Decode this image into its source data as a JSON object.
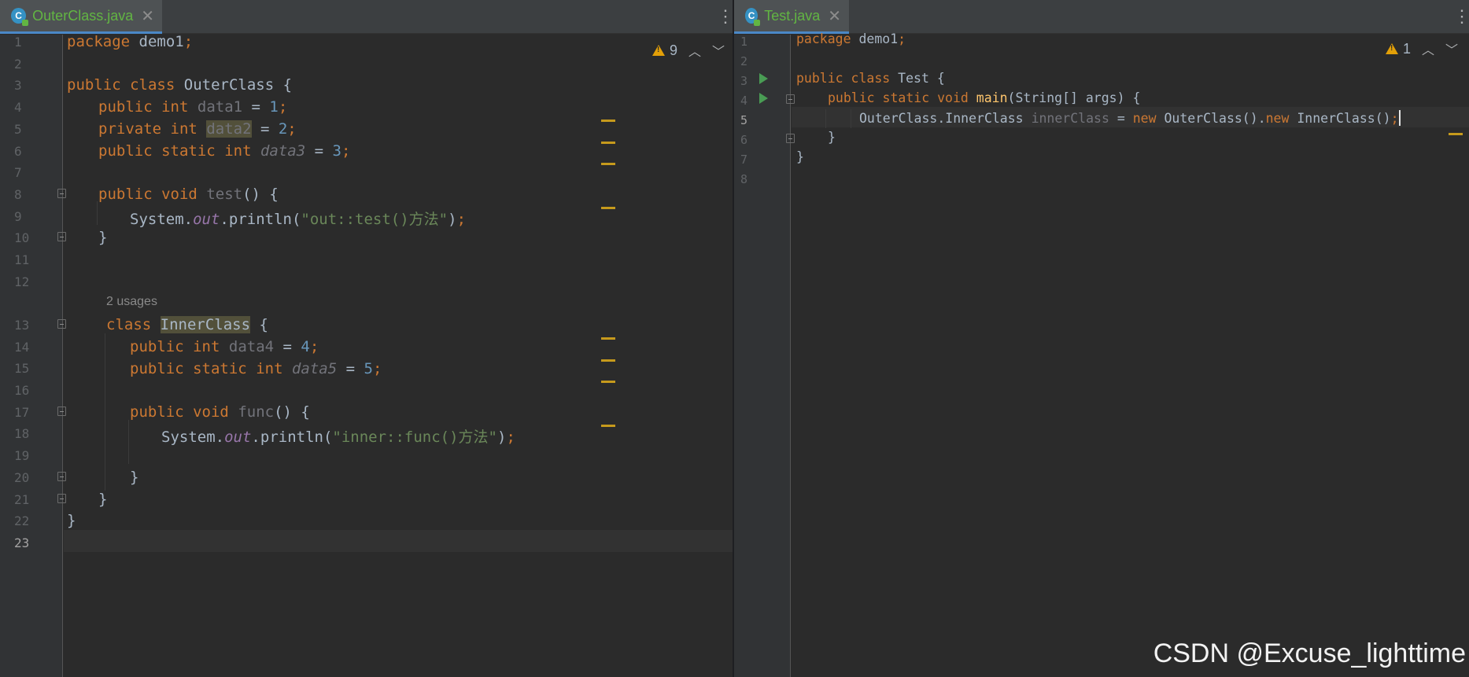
{
  "left_editor": {
    "tab": {
      "icon_letter": "C",
      "filename": "OuterClass.java",
      "close": "✕"
    },
    "inspections": {
      "warning_count": "9"
    },
    "lines": [
      {
        "n": "1"
      },
      {
        "n": "2"
      },
      {
        "n": "3"
      },
      {
        "n": "4"
      },
      {
        "n": "5"
      },
      {
        "n": "6"
      },
      {
        "n": "7"
      },
      {
        "n": "8"
      },
      {
        "n": "9"
      },
      {
        "n": "10"
      },
      {
        "n": "11"
      },
      {
        "n": "12"
      },
      {
        "n": "13"
      },
      {
        "n": "14"
      },
      {
        "n": "15"
      },
      {
        "n": "16"
      },
      {
        "n": "17"
      },
      {
        "n": "18"
      },
      {
        "n": "19"
      },
      {
        "n": "20"
      },
      {
        "n": "21"
      },
      {
        "n": "22"
      },
      {
        "n": "23"
      }
    ],
    "code": {
      "package_kw": "package",
      "package_name": "demo1",
      "public": "public",
      "private": "private",
      "class": "class",
      "int": "int",
      "static": "static",
      "void": "void",
      "outer_class": "OuterClass",
      "data1": "data1",
      "data2": "data2",
      "data3": "data3",
      "data4": "data4",
      "data5": "data5",
      "v1": "1",
      "v2": "2",
      "v3": "3",
      "v4": "4",
      "v5": "5",
      "test": "test",
      "func": "func",
      "system": "System",
      "out": "out",
      "println": "println",
      "str_test": "\"out::test()方法\"",
      "str_func": "\"inner::func()方法\"",
      "usages_hint": "2 usages",
      "inner_class": "InnerClass"
    }
  },
  "right_editor": {
    "tab": {
      "icon_letter": "C",
      "filename": "Test.java",
      "close": "✕"
    },
    "inspections": {
      "warning_count": "1"
    },
    "lines": [
      {
        "n": "1"
      },
      {
        "n": "2"
      },
      {
        "n": "3"
      },
      {
        "n": "4"
      },
      {
        "n": "5"
      },
      {
        "n": "6"
      },
      {
        "n": "7"
      },
      {
        "n": "8"
      }
    ],
    "code": {
      "package_kw": "package",
      "package_name": "demo1",
      "public": "public",
      "class": "class",
      "static": "static",
      "void": "void",
      "new": "new",
      "test_class": "Test",
      "main": "main",
      "params": "(String[] args)",
      "type": "OuterClass.InnerClass",
      "var": "innerClass",
      "outer_ctor": "OuterClass()",
      "inner_ctor": "InnerClass()"
    }
  },
  "watermark": "CSDN @Excuse_lighttime"
}
